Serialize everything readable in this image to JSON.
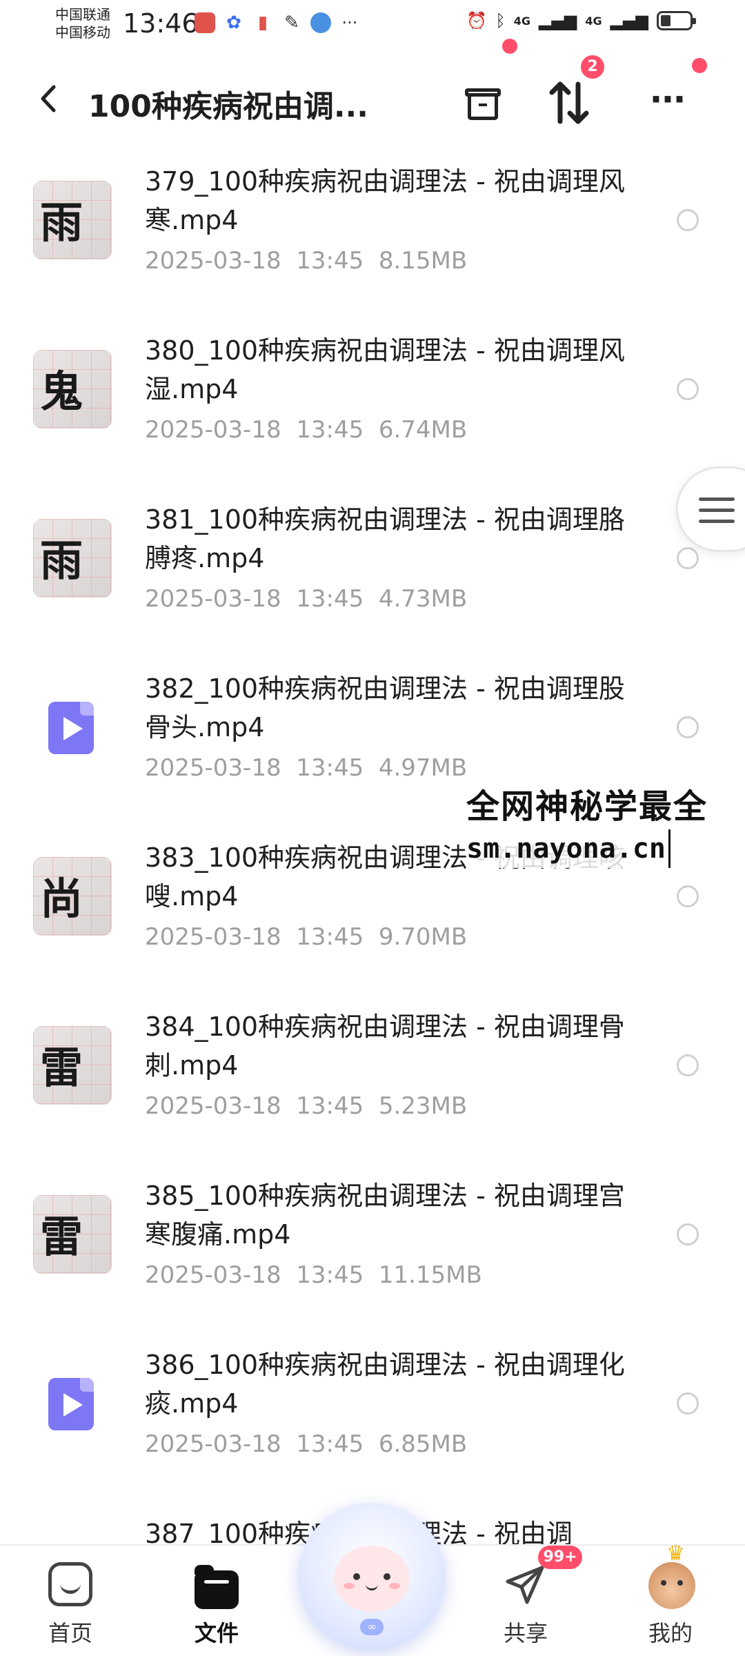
{
  "status_bar": {
    "carrier1": "中国联通",
    "carrier2": "中国移动",
    "time": "13:46",
    "net1": "4G",
    "net2": "4G"
  },
  "header": {
    "back": "<",
    "title": "100种疾病祝由调...",
    "sort_badge": "2",
    "more": "···"
  },
  "files": [
    {
      "name": "379_100种疾病祝由调理法 - 祝由调理风寒.mp4",
      "date": "2025-03-18",
      "time": "13:45",
      "size": "8.15MB",
      "thumb": "photo",
      "glyph": "雨"
    },
    {
      "name": "380_100种疾病祝由调理法 - 祝由调理风湿.mp4",
      "date": "2025-03-18",
      "time": "13:45",
      "size": "6.74MB",
      "thumb": "photo",
      "glyph": "鬼"
    },
    {
      "name": "381_100种疾病祝由调理法 - 祝由调理胳膊疼.mp4",
      "date": "2025-03-18",
      "time": "13:45",
      "size": "4.73MB",
      "thumb": "photo",
      "glyph": "雨"
    },
    {
      "name": "382_100种疾病祝由调理法 - 祝由调理股骨头.mp4",
      "date": "2025-03-18",
      "time": "13:45",
      "size": "4.97MB",
      "thumb": "video",
      "glyph": ""
    },
    {
      "name": "383_100种疾病祝由调理法 - 祝由调理咳嗖.mp4",
      "date": "2025-03-18",
      "time": "13:45",
      "size": "9.70MB",
      "thumb": "photo",
      "glyph": "尚"
    },
    {
      "name": "384_100种疾病祝由调理法 - 祝由调理骨刺.mp4",
      "date": "2025-03-18",
      "time": "13:45",
      "size": "5.23MB",
      "thumb": "photo",
      "glyph": "雷"
    },
    {
      "name": "385_100种疾病祝由调理法 - 祝由调理宫寒腹痛.mp4",
      "date": "2025-03-18",
      "time": "13:45",
      "size": "11.15MB",
      "thumb": "photo",
      "glyph": "雷"
    },
    {
      "name": "386_100种疾病祝由调理法 - 祝由调理化痰.mp4",
      "date": "2025-03-18",
      "time": "13:45",
      "size": "6.85MB",
      "thumb": "video",
      "glyph": ""
    },
    {
      "name": "387_100种疾病祝由调理法 - 祝由调",
      "date": "",
      "time": "",
      "size": "",
      "thumb": "none",
      "glyph": ""
    }
  ],
  "watermark": {
    "line1": "全网神秘学最全",
    "line2": "sm.nayona.cn"
  },
  "bottom_nav": {
    "home": "首页",
    "files": "文件",
    "share": "共享",
    "share_badge": "99+",
    "mine": "我的"
  }
}
